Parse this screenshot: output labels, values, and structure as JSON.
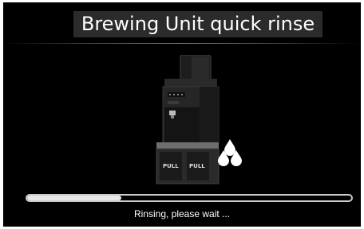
{
  "screen": {
    "title": "Brewing Unit quick rinse",
    "status_text": "Rinsing, please wait ...",
    "progress_fraction": 0.29,
    "machine_labels": [
      "PULL",
      "PULL"
    ]
  },
  "icons": {
    "machine": "coffee-machine-icon",
    "water": "water-drops-icon"
  },
  "colors": {
    "background": "#000000",
    "accent_line": "#b77a1e",
    "progress_fill": "#e8e8e8"
  }
}
